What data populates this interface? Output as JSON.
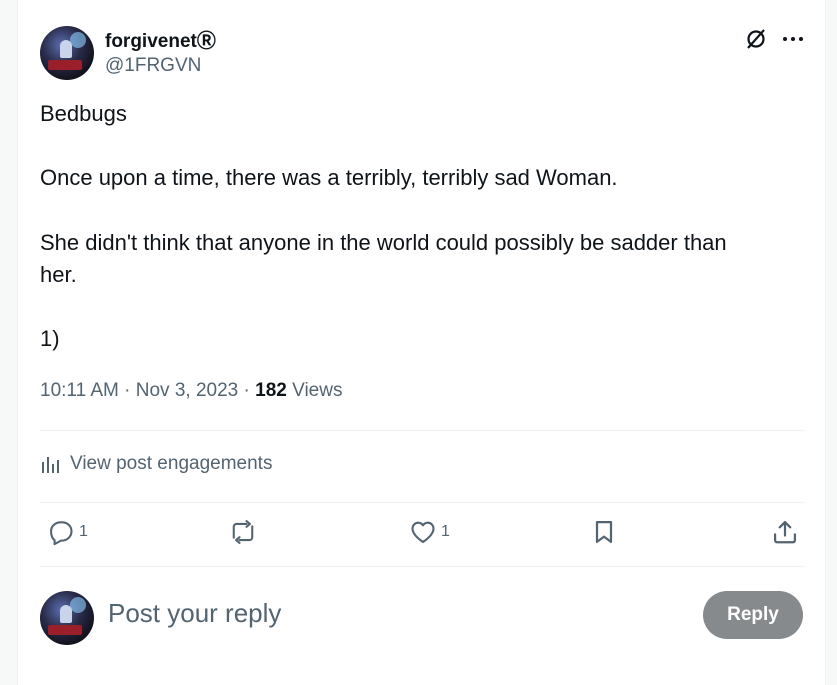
{
  "author": {
    "display_name": "forgivenetⓇ",
    "handle": "@1FRGVN"
  },
  "post": {
    "lines": [
      "Bedbugs",
      "Once upon a time, there was a terribly, terribly sad Woman.",
      "She didn't think that anyone in the world could possibly be sadder than",
      "her.",
      "1)"
    ],
    "time": "10:11 AM",
    "date": "Nov 3, 2023",
    "separator": "·",
    "views_count": "182",
    "views_label": "Views"
  },
  "engagements_label": "View post engagements",
  "actions": {
    "replies": "1",
    "likes": "1"
  },
  "reply_box": {
    "placeholder": "Post your reply",
    "button_label": "Reply"
  },
  "icons": [
    "grok-icon",
    "more-icon",
    "analytics-icon",
    "reply-icon",
    "repost-icon",
    "like-icon",
    "bookmark-icon",
    "share-icon"
  ],
  "colors": {
    "text": "#0f1419",
    "secondary": "#536471",
    "reply_button": "#878a8c",
    "divider": "#eff3f4"
  }
}
